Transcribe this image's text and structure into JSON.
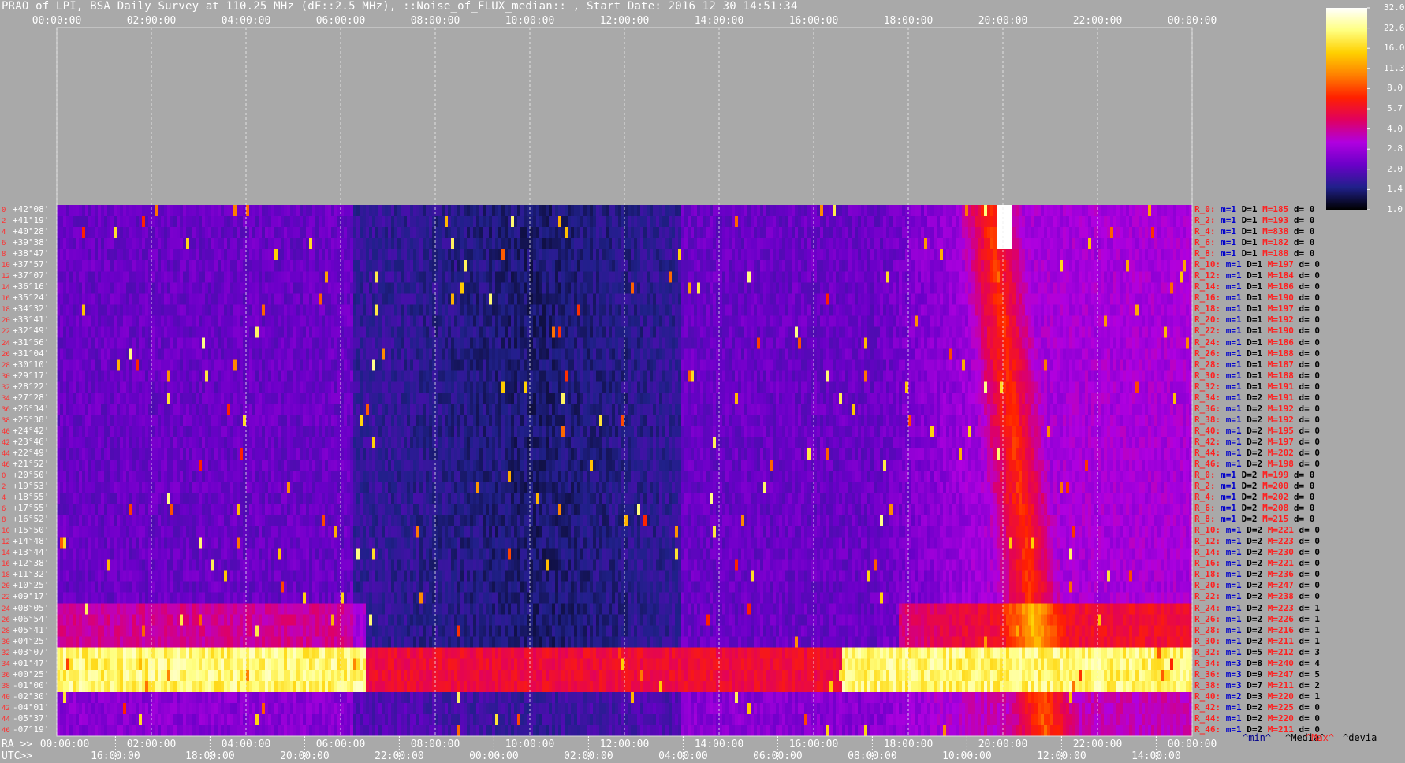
{
  "title": "PRAO of LPI, BSA Daily Survey at 110.25 MHz (dF::2.5 MHz), ::Noise_of_FLUX_median:: , Start Date: 2016 12 30 14:51:34",
  "chart_data": {
    "type": "heatmap",
    "title": "PRAO of LPI, BSA Daily Survey at 110.25 MHz (dF::2.5 MHz), ::Noise_of_FLUX_median:: , Start Date: 2016 12 30 14:51:34",
    "top_axis_ticks": [
      "00:00:00",
      "02:00:00",
      "04:00:00",
      "06:00:00",
      "08:00:00",
      "10:00:00",
      "12:00:00",
      "14:00:00",
      "16:00:00",
      "18:00:00",
      "20:00:00",
      "22:00:00",
      "00:00:00"
    ],
    "bottom_axis": {
      "ra_prefix": "RA >>",
      "ra_ticks": [
        "00:00:00",
        "02:00:00",
        "04:00:00",
        "06:00:00",
        "08:00:00",
        "10:00:00",
        "12:00:00",
        "14:00:00",
        "16:00:00",
        "18:00:00",
        "20:00:00",
        "22:00:00",
        "00:00:00"
      ],
      "utc_prefix": "UTC>>",
      "utc_ticks": [
        "16:00:00",
        "18:00:00",
        "20:00:00",
        "22:00:00",
        "00:00:00",
        "02:00:00",
        "04:00:00",
        "06:00:00",
        "08:00:00",
        "10:00:00",
        "12:00:00",
        "14:00:00"
      ]
    },
    "colorbar": {
      "ticks": [
        "32.0",
        "22.6",
        "16.0",
        "11.3",
        "8.0",
        "5.7",
        "4.0",
        "2.8",
        "2.0",
        "1.4",
        "1.0"
      ],
      "scale": "log",
      "range": [
        1.0,
        32.0
      ],
      "colors": [
        "#000000",
        "#20208a",
        "#6a00c8",
        "#b000e0",
        "#e00060",
        "#ff2000",
        "#ff8000",
        "#ffd000",
        "#ffff80",
        "#ffffff"
      ]
    },
    "declination_rows": [
      {
        "idx": "0",
        "dec": "+42°08'"
      },
      {
        "idx": "2",
        "dec": "+41°19'"
      },
      {
        "idx": "4",
        "dec": "+40°28'"
      },
      {
        "idx": "6",
        "dec": "+39°38'"
      },
      {
        "idx": "8",
        "dec": "+38°47'"
      },
      {
        "idx": "10",
        "dec": "+37°57'"
      },
      {
        "idx": "12",
        "dec": "+37°07'"
      },
      {
        "idx": "14",
        "dec": "+36°16'"
      },
      {
        "idx": "16",
        "dec": "+35°24'"
      },
      {
        "idx": "18",
        "dec": "+34°32'"
      },
      {
        "idx": "20",
        "dec": "+33°41'"
      },
      {
        "idx": "22",
        "dec": "+32°49'"
      },
      {
        "idx": "24",
        "dec": "+31°56'"
      },
      {
        "idx": "26",
        "dec": "+31°04'"
      },
      {
        "idx": "28",
        "dec": "+30°10'"
      },
      {
        "idx": "30",
        "dec": "+29°17'"
      },
      {
        "idx": "32",
        "dec": "+28°22'"
      },
      {
        "idx": "34",
        "dec": "+27°28'"
      },
      {
        "idx": "36",
        "dec": "+26°34'"
      },
      {
        "idx": "38",
        "dec": "+25°38'"
      },
      {
        "idx": "40",
        "dec": "+24°42'"
      },
      {
        "idx": "42",
        "dec": "+23°46'"
      },
      {
        "idx": "44",
        "dec": "+22°49'"
      },
      {
        "idx": "46",
        "dec": "+21°52'"
      },
      {
        "idx": "0",
        "dec": "+20°50'"
      },
      {
        "idx": "2",
        "dec": "+19°53'"
      },
      {
        "idx": "4",
        "dec": "+18°55'"
      },
      {
        "idx": "6",
        "dec": "+17°55'"
      },
      {
        "idx": "8",
        "dec": "+16°52'"
      },
      {
        "idx": "10",
        "dec": "+15°50'"
      },
      {
        "idx": "12",
        "dec": "+14°48'"
      },
      {
        "idx": "14",
        "dec": "+13°44'"
      },
      {
        "idx": "16",
        "dec": "+12°38'"
      },
      {
        "idx": "18",
        "dec": "+11°32'"
      },
      {
        "idx": "20",
        "dec": "+10°25'"
      },
      {
        "idx": "22",
        "dec": "+09°17'"
      },
      {
        "idx": "24",
        "dec": "+08°05'"
      },
      {
        "idx": "26",
        "dec": "+06°54'"
      },
      {
        "idx": "28",
        "dec": "+05°41'"
      },
      {
        "idx": "30",
        "dec": "+04°25'"
      },
      {
        "idx": "32",
        "dec": "+03°07'"
      },
      {
        "idx": "34",
        "dec": "+01°47'"
      },
      {
        "idx": "36",
        "dec": "+00°25'"
      },
      {
        "idx": "38",
        "dec": "-01°00'"
      },
      {
        "idx": "40",
        "dec": "-02°30'"
      },
      {
        "idx": "42",
        "dec": "-04°01'"
      },
      {
        "idx": "44",
        "dec": "-05°37'"
      },
      {
        "idx": "46",
        "dec": "-07°19'"
      }
    ],
    "row_stats": [
      {
        "r": "R_0:",
        "m": "m=1",
        "D": "D=1",
        "M": "M=185",
        "d": "d= 0"
      },
      {
        "r": "R_2:",
        "m": "m=1",
        "D": "D=1",
        "M": "M=193",
        "d": "d= 0"
      },
      {
        "r": "R_4:",
        "m": "m=1",
        "D": "D=1",
        "M": "M=838",
        "d": "d= 0"
      },
      {
        "r": "R_6:",
        "m": "m=1",
        "D": "D=1",
        "M": "M=182",
        "d": "d= 0"
      },
      {
        "r": "R_8:",
        "m": "m=1",
        "D": "D=1",
        "M": "M=188",
        "d": "d= 0"
      },
      {
        "r": "R_10:",
        "m": "m=1",
        "D": "D=1",
        "M": "M=197",
        "d": "d= 0"
      },
      {
        "r": "R_12:",
        "m": "m=1",
        "D": "D=1",
        "M": "M=184",
        "d": "d= 0"
      },
      {
        "r": "R_14:",
        "m": "m=1",
        "D": "D=1",
        "M": "M=186",
        "d": "d= 0"
      },
      {
        "r": "R_16:",
        "m": "m=1",
        "D": "D=1",
        "M": "M=190",
        "d": "d= 0"
      },
      {
        "r": "R_18:",
        "m": "m=1",
        "D": "D=1",
        "M": "M=197",
        "d": "d= 0"
      },
      {
        "r": "R_20:",
        "m": "m=1",
        "D": "D=1",
        "M": "M=192",
        "d": "d= 0"
      },
      {
        "r": "R_22:",
        "m": "m=1",
        "D": "D=1",
        "M": "M=190",
        "d": "d= 0"
      },
      {
        "r": "R_24:",
        "m": "m=1",
        "D": "D=1",
        "M": "M=186",
        "d": "d= 0"
      },
      {
        "r": "R_26:",
        "m": "m=1",
        "D": "D=1",
        "M": "M=188",
        "d": "d= 0"
      },
      {
        "r": "R_28:",
        "m": "m=1",
        "D": "D=1",
        "M": "M=187",
        "d": "d= 0"
      },
      {
        "r": "R_30:",
        "m": "m=1",
        "D": "D=1",
        "M": "M=188",
        "d": "d= 0"
      },
      {
        "r": "R_32:",
        "m": "m=1",
        "D": "D=1",
        "M": "M=191",
        "d": "d= 0"
      },
      {
        "r": "R_34:",
        "m": "m=1",
        "D": "D=2",
        "M": "M=191",
        "d": "d= 0"
      },
      {
        "r": "R_36:",
        "m": "m=1",
        "D": "D=2",
        "M": "M=192",
        "d": "d= 0"
      },
      {
        "r": "R_38:",
        "m": "m=1",
        "D": "D=2",
        "M": "M=192",
        "d": "d= 0"
      },
      {
        "r": "R_40:",
        "m": "m=1",
        "D": "D=2",
        "M": "M=195",
        "d": "d= 0"
      },
      {
        "r": "R_42:",
        "m": "m=1",
        "D": "D=2",
        "M": "M=197",
        "d": "d= 0"
      },
      {
        "r": "R_44:",
        "m": "m=1",
        "D": "D=2",
        "M": "M=202",
        "d": "d= 0"
      },
      {
        "r": "R_46:",
        "m": "m=1",
        "D": "D=2",
        "M": "M=198",
        "d": "d= 0"
      },
      {
        "r": "R_0:",
        "m": "m=1",
        "D": "D=2",
        "M": "M=199",
        "d": "d= 0"
      },
      {
        "r": "R_2:",
        "m": "m=1",
        "D": "D=2",
        "M": "M=200",
        "d": "d= 0"
      },
      {
        "r": "R_4:",
        "m": "m=1",
        "D": "D=2",
        "M": "M=202",
        "d": "d= 0"
      },
      {
        "r": "R_6:",
        "m": "m=1",
        "D": "D=2",
        "M": "M=208",
        "d": "d= 0"
      },
      {
        "r": "R_8:",
        "m": "m=1",
        "D": "D=2",
        "M": "M=215",
        "d": "d= 0"
      },
      {
        "r": "R_10:",
        "m": "m=1",
        "D": "D=2",
        "M": "M=221",
        "d": "d= 0"
      },
      {
        "r": "R_12:",
        "m": "m=1",
        "D": "D=2",
        "M": "M=223",
        "d": "d= 0"
      },
      {
        "r": "R_14:",
        "m": "m=1",
        "D": "D=2",
        "M": "M=230",
        "d": "d= 0"
      },
      {
        "r": "R_16:",
        "m": "m=1",
        "D": "D=2",
        "M": "M=221",
        "d": "d= 0"
      },
      {
        "r": "R_18:",
        "m": "m=1",
        "D": "D=2",
        "M": "M=236",
        "d": "d= 0"
      },
      {
        "r": "R_20:",
        "m": "m=1",
        "D": "D=2",
        "M": "M=247",
        "d": "d= 0"
      },
      {
        "r": "R_22:",
        "m": "m=1",
        "D": "D=2",
        "M": "M=238",
        "d": "d= 0"
      },
      {
        "r": "R_24:",
        "m": "m=1",
        "D": "D=2",
        "M": "M=223",
        "d": "d= 1"
      },
      {
        "r": "R_26:",
        "m": "m=1",
        "D": "D=2",
        "M": "M=226",
        "d": "d= 1"
      },
      {
        "r": "R_28:",
        "m": "m=1",
        "D": "D=2",
        "M": "M=216",
        "d": "d= 1"
      },
      {
        "r": "R_30:",
        "m": "m=1",
        "D": "D=2",
        "M": "M=211",
        "d": "d= 1"
      },
      {
        "r": "R_32:",
        "m": "m=1",
        "D": "D=5",
        "M": "M=212",
        "d": "d= 3"
      },
      {
        "r": "R_34:",
        "m": "m=3",
        "D": "D=8",
        "M": "M=240",
        "d": "d= 4"
      },
      {
        "r": "R_36:",
        "m": "m=3",
        "D": "D=9",
        "M": "M=247",
        "d": "d= 5"
      },
      {
        "r": "R_38:",
        "m": "m=3",
        "D": "D=7",
        "M": "M=211",
        "d": "d= 2"
      },
      {
        "r": "R_40:",
        "m": "m=2",
        "D": "D=3",
        "M": "M=220",
        "d": "d= 1"
      },
      {
        "r": "R_42:",
        "m": "m=1",
        "D": "D=2",
        "M": "M=225",
        "d": "d= 0"
      },
      {
        "r": "R_44:",
        "m": "m=1",
        "D": "D=2",
        "M": "M=220",
        "d": "d= 0"
      },
      {
        "r": "R_46:",
        "m": "m=1",
        "D": "D=2",
        "M": "M=211",
        "d": "d= 0"
      }
    ],
    "stat_legend": {
      "min": "^min^",
      "median": "^Media^",
      "max": "^Max^",
      "devia": "^devia"
    }
  }
}
